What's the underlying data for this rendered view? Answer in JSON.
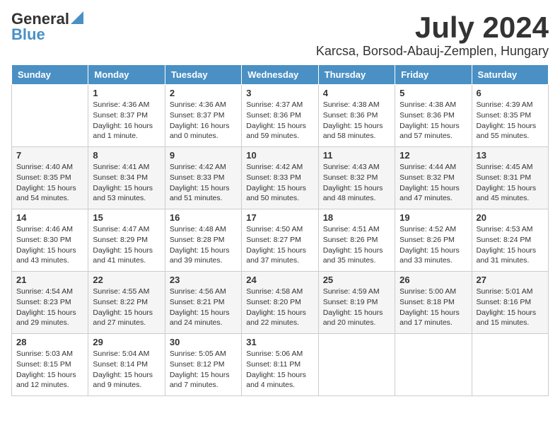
{
  "logo": {
    "general": "General",
    "blue": "Blue"
  },
  "title": "July 2024",
  "location": "Karcsa, Borsod-Abauj-Zemplen, Hungary",
  "days_of_week": [
    "Sunday",
    "Monday",
    "Tuesday",
    "Wednesday",
    "Thursday",
    "Friday",
    "Saturday"
  ],
  "weeks": [
    [
      {
        "day": "",
        "info": ""
      },
      {
        "day": "1",
        "info": "Sunrise: 4:36 AM\nSunset: 8:37 PM\nDaylight: 16 hours\nand 1 minute."
      },
      {
        "day": "2",
        "info": "Sunrise: 4:36 AM\nSunset: 8:37 PM\nDaylight: 16 hours\nand 0 minutes."
      },
      {
        "day": "3",
        "info": "Sunrise: 4:37 AM\nSunset: 8:36 PM\nDaylight: 15 hours\nand 59 minutes."
      },
      {
        "day": "4",
        "info": "Sunrise: 4:38 AM\nSunset: 8:36 PM\nDaylight: 15 hours\nand 58 minutes."
      },
      {
        "day": "5",
        "info": "Sunrise: 4:38 AM\nSunset: 8:36 PM\nDaylight: 15 hours\nand 57 minutes."
      },
      {
        "day": "6",
        "info": "Sunrise: 4:39 AM\nSunset: 8:35 PM\nDaylight: 15 hours\nand 55 minutes."
      }
    ],
    [
      {
        "day": "7",
        "info": "Sunrise: 4:40 AM\nSunset: 8:35 PM\nDaylight: 15 hours\nand 54 minutes."
      },
      {
        "day": "8",
        "info": "Sunrise: 4:41 AM\nSunset: 8:34 PM\nDaylight: 15 hours\nand 53 minutes."
      },
      {
        "day": "9",
        "info": "Sunrise: 4:42 AM\nSunset: 8:33 PM\nDaylight: 15 hours\nand 51 minutes."
      },
      {
        "day": "10",
        "info": "Sunrise: 4:42 AM\nSunset: 8:33 PM\nDaylight: 15 hours\nand 50 minutes."
      },
      {
        "day": "11",
        "info": "Sunrise: 4:43 AM\nSunset: 8:32 PM\nDaylight: 15 hours\nand 48 minutes."
      },
      {
        "day": "12",
        "info": "Sunrise: 4:44 AM\nSunset: 8:32 PM\nDaylight: 15 hours\nand 47 minutes."
      },
      {
        "day": "13",
        "info": "Sunrise: 4:45 AM\nSunset: 8:31 PM\nDaylight: 15 hours\nand 45 minutes."
      }
    ],
    [
      {
        "day": "14",
        "info": "Sunrise: 4:46 AM\nSunset: 8:30 PM\nDaylight: 15 hours\nand 43 minutes."
      },
      {
        "day": "15",
        "info": "Sunrise: 4:47 AM\nSunset: 8:29 PM\nDaylight: 15 hours\nand 41 minutes."
      },
      {
        "day": "16",
        "info": "Sunrise: 4:48 AM\nSunset: 8:28 PM\nDaylight: 15 hours\nand 39 minutes."
      },
      {
        "day": "17",
        "info": "Sunrise: 4:50 AM\nSunset: 8:27 PM\nDaylight: 15 hours\nand 37 minutes."
      },
      {
        "day": "18",
        "info": "Sunrise: 4:51 AM\nSunset: 8:26 PM\nDaylight: 15 hours\nand 35 minutes."
      },
      {
        "day": "19",
        "info": "Sunrise: 4:52 AM\nSunset: 8:26 PM\nDaylight: 15 hours\nand 33 minutes."
      },
      {
        "day": "20",
        "info": "Sunrise: 4:53 AM\nSunset: 8:24 PM\nDaylight: 15 hours\nand 31 minutes."
      }
    ],
    [
      {
        "day": "21",
        "info": "Sunrise: 4:54 AM\nSunset: 8:23 PM\nDaylight: 15 hours\nand 29 minutes."
      },
      {
        "day": "22",
        "info": "Sunrise: 4:55 AM\nSunset: 8:22 PM\nDaylight: 15 hours\nand 27 minutes."
      },
      {
        "day": "23",
        "info": "Sunrise: 4:56 AM\nSunset: 8:21 PM\nDaylight: 15 hours\nand 24 minutes."
      },
      {
        "day": "24",
        "info": "Sunrise: 4:58 AM\nSunset: 8:20 PM\nDaylight: 15 hours\nand 22 minutes."
      },
      {
        "day": "25",
        "info": "Sunrise: 4:59 AM\nSunset: 8:19 PM\nDaylight: 15 hours\nand 20 minutes."
      },
      {
        "day": "26",
        "info": "Sunrise: 5:00 AM\nSunset: 8:18 PM\nDaylight: 15 hours\nand 17 minutes."
      },
      {
        "day": "27",
        "info": "Sunrise: 5:01 AM\nSunset: 8:16 PM\nDaylight: 15 hours\nand 15 minutes."
      }
    ],
    [
      {
        "day": "28",
        "info": "Sunrise: 5:03 AM\nSunset: 8:15 PM\nDaylight: 15 hours\nand 12 minutes."
      },
      {
        "day": "29",
        "info": "Sunrise: 5:04 AM\nSunset: 8:14 PM\nDaylight: 15 hours\nand 9 minutes."
      },
      {
        "day": "30",
        "info": "Sunrise: 5:05 AM\nSunset: 8:12 PM\nDaylight: 15 hours\nand 7 minutes."
      },
      {
        "day": "31",
        "info": "Sunrise: 5:06 AM\nSunset: 8:11 PM\nDaylight: 15 hours\nand 4 minutes."
      },
      {
        "day": "",
        "info": ""
      },
      {
        "day": "",
        "info": ""
      },
      {
        "day": "",
        "info": ""
      }
    ]
  ]
}
